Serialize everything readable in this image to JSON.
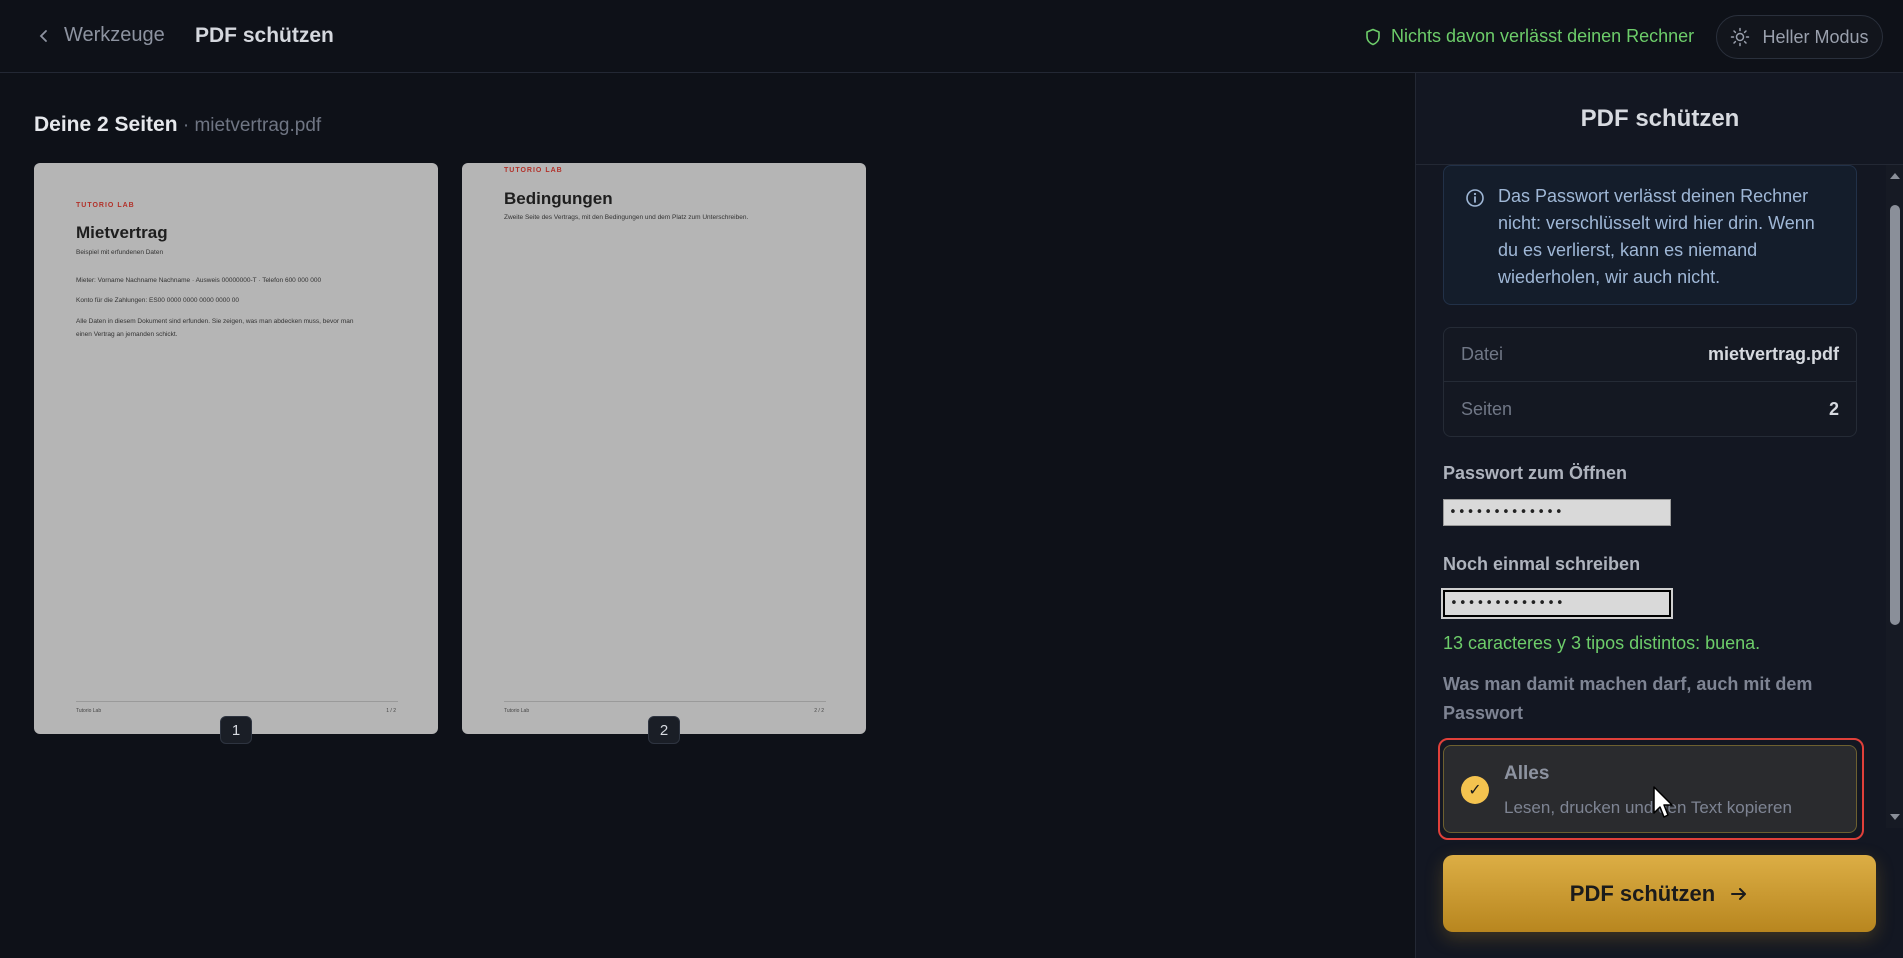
{
  "header": {
    "back_label": "Werkzeuge",
    "title": "PDF schützen",
    "privacy_note": "Nichts davon verlässt deinen Rechner",
    "mode_button": "Heller Modus"
  },
  "pages_section": {
    "heading": "Deine 2 Seiten",
    "separator": " · ",
    "filename": "mietvertrag.pdf"
  },
  "pages": [
    {
      "number": "1",
      "brand": "TUTORIO LAB",
      "title": "Mietvertrag",
      "subtitle": "Beispiel mit erfundenen Daten",
      "lines": [
        "Mieter: Vorname Nachname Nachname · Ausweis 00000000-T · Telefon 600 000 000",
        "Konto für die Zahlungen: ES00 0000 0000 0000 0000 00",
        "Alle Daten in diesem Dokument sind erfunden. Sie zeigen, was man abdecken muss, bevor man",
        "einen Vertrag an jemanden schickt."
      ],
      "footer_left": "Tutorio Lab",
      "footer_right": "1 / 2"
    },
    {
      "number": "2",
      "brand": "TUTORIO LAB",
      "title": "Bedingungen",
      "subtitle": "Zweite Seite des Vertrags, mit den Bedingungen und dem Platz zum Unterschreiben.",
      "lines": [],
      "footer_left": "Tutorio Lab",
      "footer_right": "2 / 2"
    }
  ],
  "panel": {
    "title": "PDF schützen",
    "info": "Das Passwort verlässt deinen Rechner nicht: verschlüsselt wird hier drin. Wenn du es verlierst, kann es niemand wiederholen, wir auch nicht.",
    "meta": [
      {
        "label": "Datei",
        "value": "mietvertrag.pdf"
      },
      {
        "label": "Seiten",
        "value": "2"
      }
    ],
    "password_label": "Passwort zum Öffnen",
    "password_value": "•••••••••••••",
    "confirm_label": "Noch einmal schreiben",
    "confirm_value": "•••••••••••••",
    "strength_text": "13 caracteres y 3 tipos distintos: buena.",
    "permissions_label": "Was man damit machen darf, auch mit dem Passwort",
    "option": {
      "title": "Alles",
      "description": "Lesen, drucken und den Text kopieren",
      "checked": true
    },
    "submit_label": "PDF schützen"
  },
  "colors": {
    "background": "#0e1118",
    "panel": "#131722",
    "accent": "#dcae45",
    "success": "#6dcd6a",
    "highlight": "#e0403a"
  }
}
